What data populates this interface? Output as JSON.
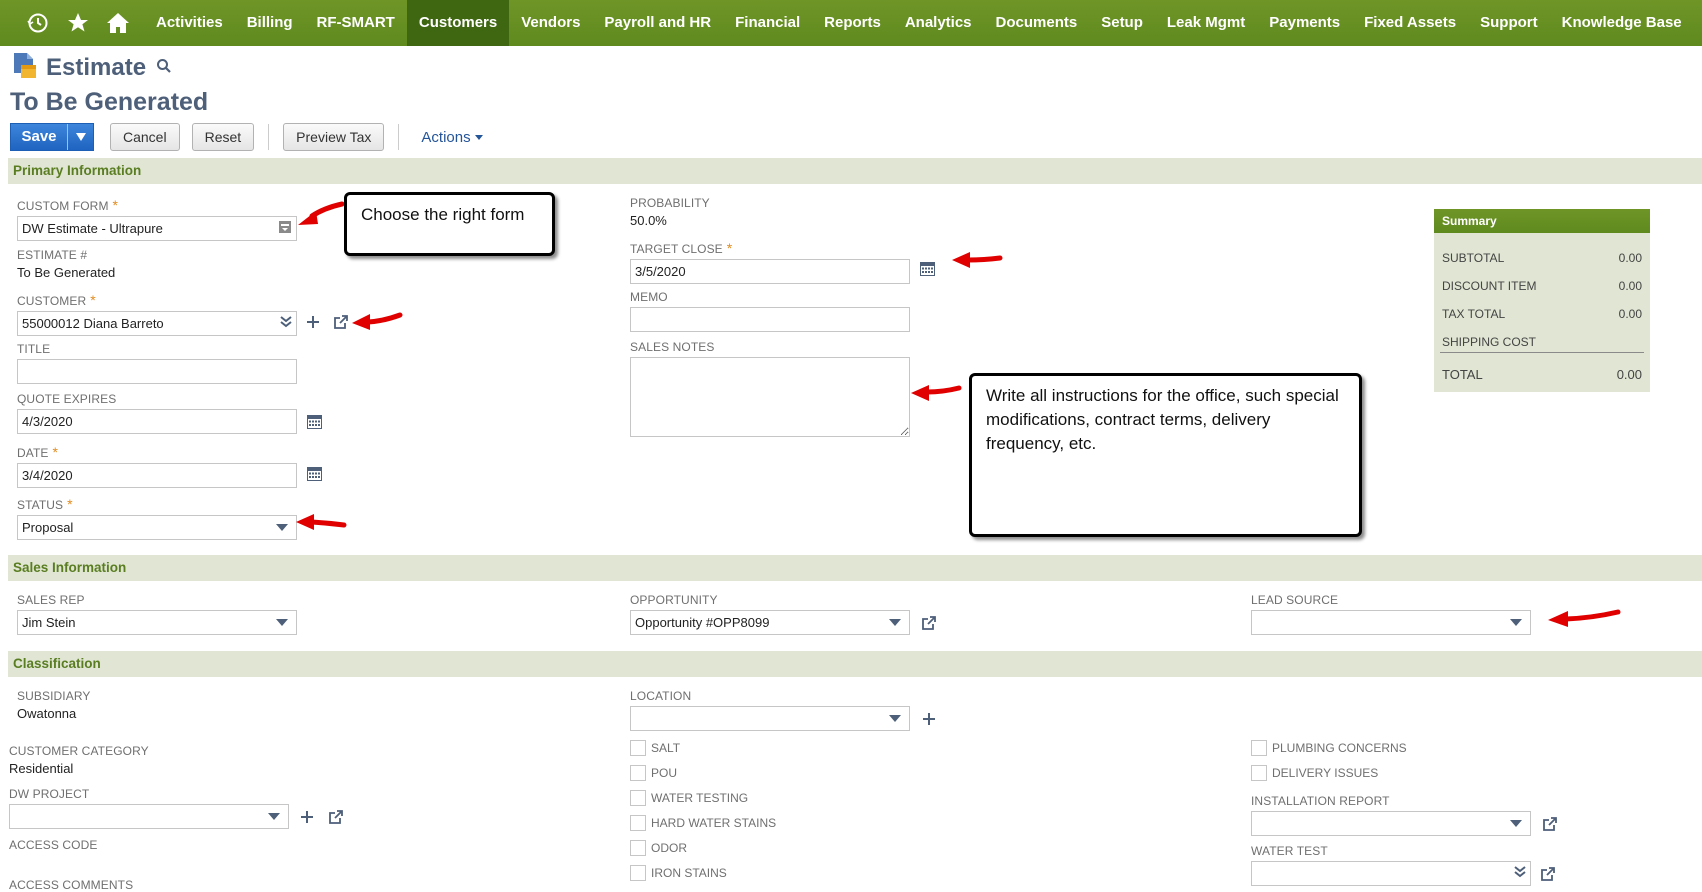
{
  "nav": {
    "icons": [
      "recent-icon",
      "star-icon",
      "home-icon"
    ],
    "items": [
      {
        "label": "Activities"
      },
      {
        "label": "Billing"
      },
      {
        "label": "RF-SMART"
      },
      {
        "label": "Customers",
        "active": true
      },
      {
        "label": "Vendors"
      },
      {
        "label": "Payroll and HR"
      },
      {
        "label": "Financial"
      },
      {
        "label": "Reports"
      },
      {
        "label": "Analytics"
      },
      {
        "label": "Documents"
      },
      {
        "label": "Setup"
      },
      {
        "label": "Leak Mgmt"
      },
      {
        "label": "Payments"
      },
      {
        "label": "Fixed Assets"
      },
      {
        "label": "Support"
      },
      {
        "label": "Knowledge Base"
      }
    ]
  },
  "header": {
    "record_type": "Estimate",
    "record_name": "To Be Generated"
  },
  "toolbar": {
    "save": "Save",
    "cancel": "Cancel",
    "reset": "Reset",
    "preview_tax": "Preview Tax",
    "actions": "Actions"
  },
  "sections": {
    "primary": "Primary Information",
    "sales": "Sales Information",
    "classification": "Classification"
  },
  "primary": {
    "custom_form": {
      "label": "Custom Form",
      "value": "DW Estimate - Ultrapure"
    },
    "estimate_no": {
      "label": "Estimate #",
      "value": "To Be Generated"
    },
    "customer": {
      "label": "Customer",
      "value": "55000012 Diana Barreto"
    },
    "title": {
      "label": "Title",
      "value": ""
    },
    "quote_expires": {
      "label": "Quote Expires",
      "value": "4/3/2020"
    },
    "date": {
      "label": "Date",
      "value": "3/4/2020"
    },
    "status": {
      "label": "Status",
      "value": "Proposal"
    },
    "probability": {
      "label": "Probability",
      "value": "50.0%"
    },
    "target_close": {
      "label": "Target Close",
      "value": "3/5/2020"
    },
    "memo": {
      "label": "Memo",
      "value": ""
    },
    "sales_notes": {
      "label": "Sales Notes",
      "value": ""
    }
  },
  "summary": {
    "title": "Summary",
    "rows": [
      {
        "label": "Subtotal",
        "value": "0.00"
      },
      {
        "label": "Discount Item",
        "value": "0.00"
      },
      {
        "label": "Tax Total",
        "value": "0.00"
      },
      {
        "label": "Shipping Cost",
        "value": ""
      }
    ],
    "total": {
      "label": "Total",
      "value": "0.00"
    }
  },
  "sales": {
    "sales_rep": {
      "label": "Sales Rep",
      "value": "Jim Stein"
    },
    "opportunity": {
      "label": "Opportunity",
      "value": "Opportunity #OPP8099"
    },
    "lead_source": {
      "label": "Lead Source",
      "value": ""
    }
  },
  "classification": {
    "subsidiary": {
      "label": "Subsidiary",
      "value": "Owatonna"
    },
    "customer_category": {
      "label": "Customer Category",
      "value": "Residential"
    },
    "dw_project": {
      "label": "DW Project",
      "value": ""
    },
    "access_code": {
      "label": "Access Code"
    },
    "access_comments": {
      "label": "Access Comments"
    },
    "location": {
      "label": "Location",
      "value": ""
    },
    "checkboxes_mid": [
      "Salt",
      "POU",
      "Water Testing",
      "Hard Water Stains",
      "Odor",
      "Iron Stains"
    ],
    "checkboxes_right": [
      "Plumbing Concerns",
      "Delivery Issues"
    ],
    "installation_report": {
      "label": "Installation Report",
      "value": ""
    },
    "water_test": {
      "label": "Water Test",
      "value": ""
    }
  },
  "callouts": {
    "form": "Choose the right form",
    "notes": "Write all instructions for the office, such special modifications, contract terms, delivery frequency, etc."
  },
  "colors": {
    "nav_bg": "#6b8e23",
    "nav_active": "#3f6712",
    "section_bg": "#e0e6d3",
    "section_text": "#5a7d22",
    "primary_button": "#2f77d0",
    "arrow": "#e00000"
  }
}
